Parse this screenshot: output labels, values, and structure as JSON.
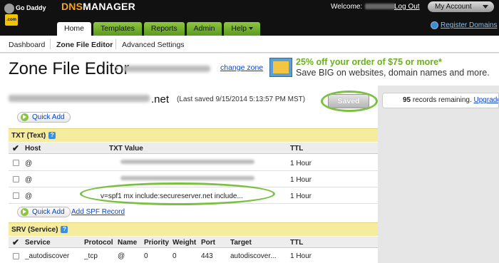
{
  "header": {
    "logo_text": "Go Daddy",
    "logo_tag": ".com",
    "product_prefix": "DNS",
    "product_suffix": "MANAGER",
    "welcome": "Welcome:",
    "logout": "Log Out",
    "my_account": "My Account",
    "register": "Register Domains"
  },
  "tabs": [
    {
      "label": "Home",
      "active": true,
      "dropdown": false
    },
    {
      "label": "Templates",
      "active": false,
      "dropdown": false
    },
    {
      "label": "Reports",
      "active": false,
      "dropdown": false
    },
    {
      "label": "Admin",
      "active": false,
      "dropdown": false
    },
    {
      "label": "Help",
      "active": false,
      "dropdown": true
    }
  ],
  "subnav": {
    "dashboard": "Dashboard",
    "zone_file_editor": "Zone File Editor",
    "advanced_settings": "Advanced Settings"
  },
  "page": {
    "title": "Zone File Editor",
    "change_zone": "change zone",
    "promo_line1": "25% off your order of $75 or more*",
    "promo_line2": "Save BIG on websites, domain names and more."
  },
  "domain": {
    "tld": ".net",
    "last_saved": "(Last saved 9/15/2014 5:13:57 PM MST)",
    "saved_button": "Saved"
  },
  "records": {
    "count": "95",
    "text": "records remaining.",
    "upgrade": "Upgrade"
  },
  "quick_add": "Quick Add",
  "add_spf": "Add SPF Record",
  "txt_section": {
    "title": "TXT (Text)",
    "columns": {
      "host": "Host",
      "value": "TXT Value",
      "ttl": "TTL"
    },
    "rows": [
      {
        "host": "@",
        "value": "",
        "ttl": "1 Hour"
      },
      {
        "host": "@",
        "value": "",
        "ttl": "1 Hour"
      },
      {
        "host": "@",
        "value": "v=spf1 mx include:secureserver.net include...",
        "ttl": "1 Hour"
      }
    ]
  },
  "srv_section": {
    "title": "SRV (Service)",
    "columns": {
      "service": "Service",
      "protocol": "Protocol",
      "name": "Name",
      "priority": "Priority",
      "weight": "Weight",
      "port": "Port",
      "target": "Target",
      "ttl": "TTL"
    },
    "row": {
      "service": "_autodiscover",
      "protocol": "_tcp",
      "name": "@",
      "priority": "0",
      "weight": "0",
      "port": "443",
      "target": "autodiscover...",
      "ttl": "1 Hour"
    }
  },
  "colors": {
    "header_bg": "#111111",
    "tab_green": "#6aaa26",
    "section_yellow": "#f5ec9d",
    "link_blue": "#0a46c2",
    "highlight_ring": "#7bc043",
    "promo_green": "#6bb11c"
  },
  "icons": [
    "godaddy-logo",
    "caret-down-icon",
    "globe-icon",
    "promo-icon",
    "plus-icon",
    "help-icon",
    "checkmark-icon",
    "checkbox-icon"
  ]
}
